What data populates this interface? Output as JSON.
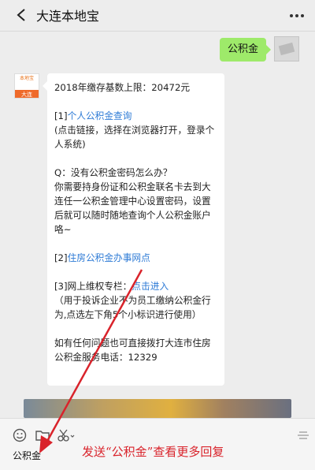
{
  "header": {
    "title": "大连本地宝"
  },
  "user_message": {
    "text": "公积金"
  },
  "bot_avatar": {
    "top_text": "本地宝",
    "bottom_text": "大连"
  },
  "reply": {
    "line1": "2018年缴存基数上限：20472元",
    "item1_prefix": "[1]",
    "item1_link": "个人公积金查询",
    "item1_desc": "(点击链接，选择在浏览器打开，登录个人系统)",
    "qa_q": "Q：没有公积金密码怎么办？",
    "qa_a": "你需要持身份证和公积金联名卡去到大连任一公积金管理中心设置密码，设置后就可以随时随地查询个人公积金账户咯~",
    "item2_prefix": "[2]",
    "item2_link": "住房公积金办事网点",
    "item3_prefix": "[3]网上维权专栏：",
    "item3_link": "点击进入",
    "item3_desc": "（用于投诉企业不为员工缴纳公积金行为,点选左下角5个小标识进行使用）",
    "contact": "如有任何问题也可直接拨打大连市住房公积金服务电话：12329"
  },
  "toolbar": {
    "menu_label": "公积金"
  },
  "annotation": {
    "text": "发送“公积金”查看更多回复"
  },
  "colors": {
    "bubble_green": "#9eea6a",
    "link": "#2e7bd6",
    "annotation": "#d9232b"
  },
  "icons": [
    "back-arrow-icon",
    "more-dots-icon",
    "emoji-icon",
    "folder-icon",
    "scissors-icon",
    "keyboard-toggle-icon"
  ]
}
